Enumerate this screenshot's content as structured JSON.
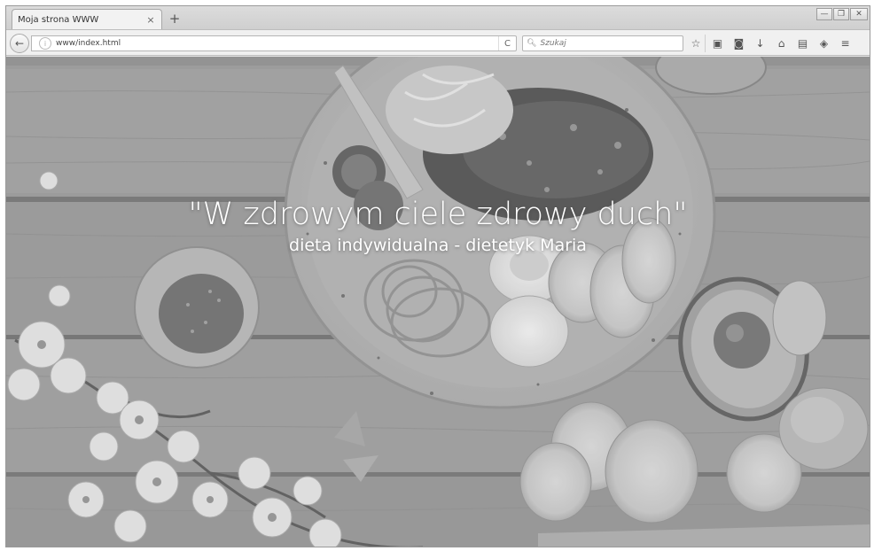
{
  "browser": {
    "tab": {
      "title": "Moja strona WWW",
      "close_glyph": "×"
    },
    "new_tab_glyph": "+",
    "window_controls": {
      "minimize": "—",
      "maximize": "❐",
      "close": "✕"
    },
    "nav": {
      "back_glyph": "←",
      "url": "www/index.html",
      "reload_glyph": "C",
      "search_placeholder": "Szukaj"
    },
    "toolbar_icons": [
      "star-icon",
      "clipboard-icon",
      "pocket-icon",
      "download-icon",
      "home-icon",
      "reader-icon",
      "extension-icon",
      "menu-icon"
    ],
    "toolbar_glyphs": [
      "☆",
      "▣",
      "◙",
      "↓",
      "⌂",
      "▤",
      "◈",
      "≡"
    ]
  },
  "page": {
    "headline": "\"W zdrowym ciele zdrowy duch\"",
    "subheadline": "dieta indywidualna - dietetyk Maria"
  },
  "colors": {
    "text": "#ffffff",
    "background_tone": "#8e8e8e"
  }
}
